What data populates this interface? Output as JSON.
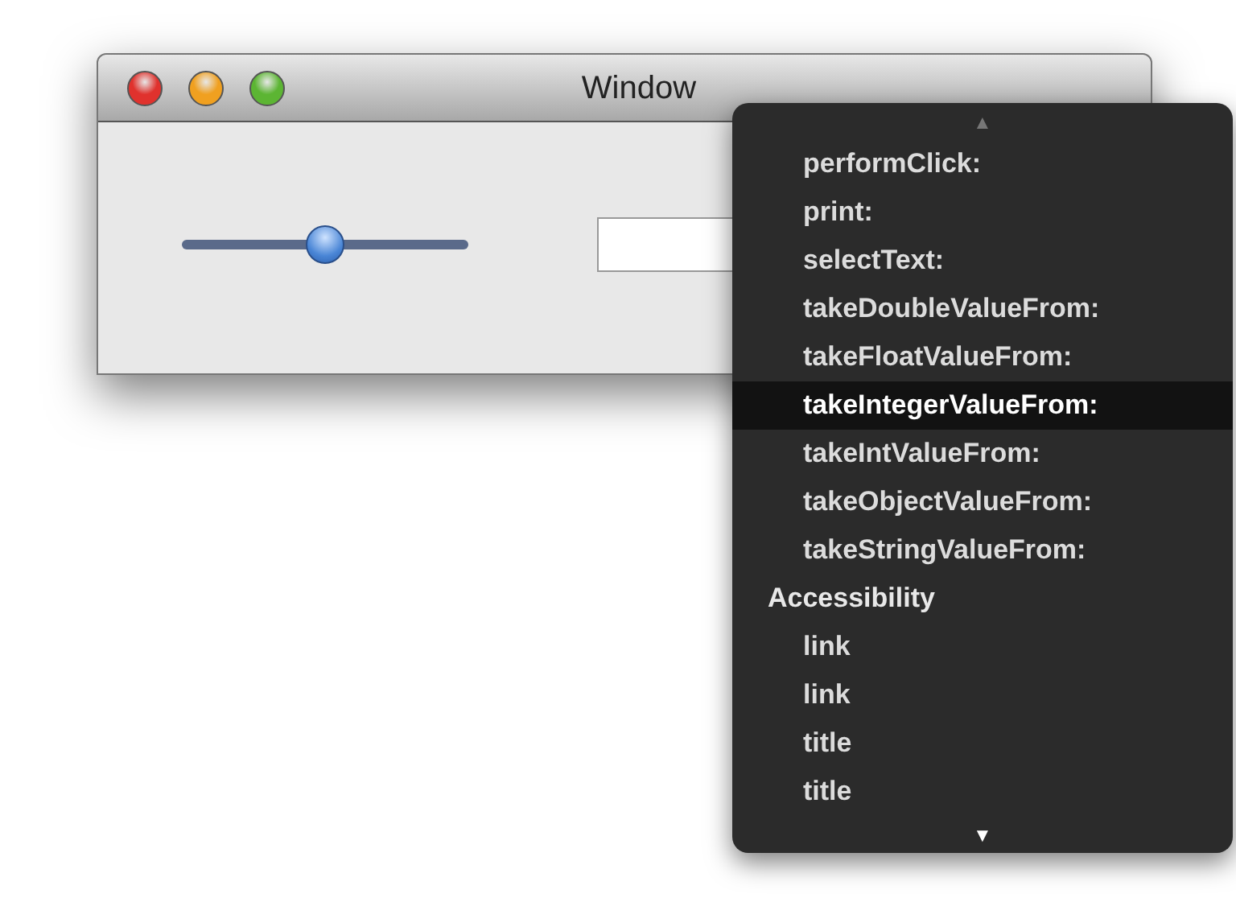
{
  "window": {
    "title": "Window"
  },
  "slider": {
    "level": 0.5
  },
  "menu": {
    "scroll_up": {
      "label": "▲",
      "disabled": true
    },
    "scroll_down": {
      "label": "▼",
      "disabled": false
    },
    "groups": [
      {
        "children": [
          {
            "label": "performClick:",
            "selected": false
          },
          {
            "label": "print:",
            "selected": false
          },
          {
            "label": "selectText:",
            "selected": false
          },
          {
            "label": "takeDoubleValueFrom:",
            "selected": false
          },
          {
            "label": "takeFloatValueFrom:",
            "selected": false
          },
          {
            "label": "takeIntegerValueFrom:",
            "selected": true
          },
          {
            "label": "takeIntValueFrom:",
            "selected": false
          },
          {
            "label": "takeObjectValueFrom:",
            "selected": false
          },
          {
            "label": "takeStringValueFrom:",
            "selected": false
          }
        ]
      },
      {
        "label": "Accessibility",
        "children": [
          {
            "label": "link",
            "selected": false
          },
          {
            "label": "link",
            "selected": false
          },
          {
            "label": "title",
            "selected": false
          },
          {
            "label": "title",
            "selected": false
          }
        ]
      }
    ]
  }
}
